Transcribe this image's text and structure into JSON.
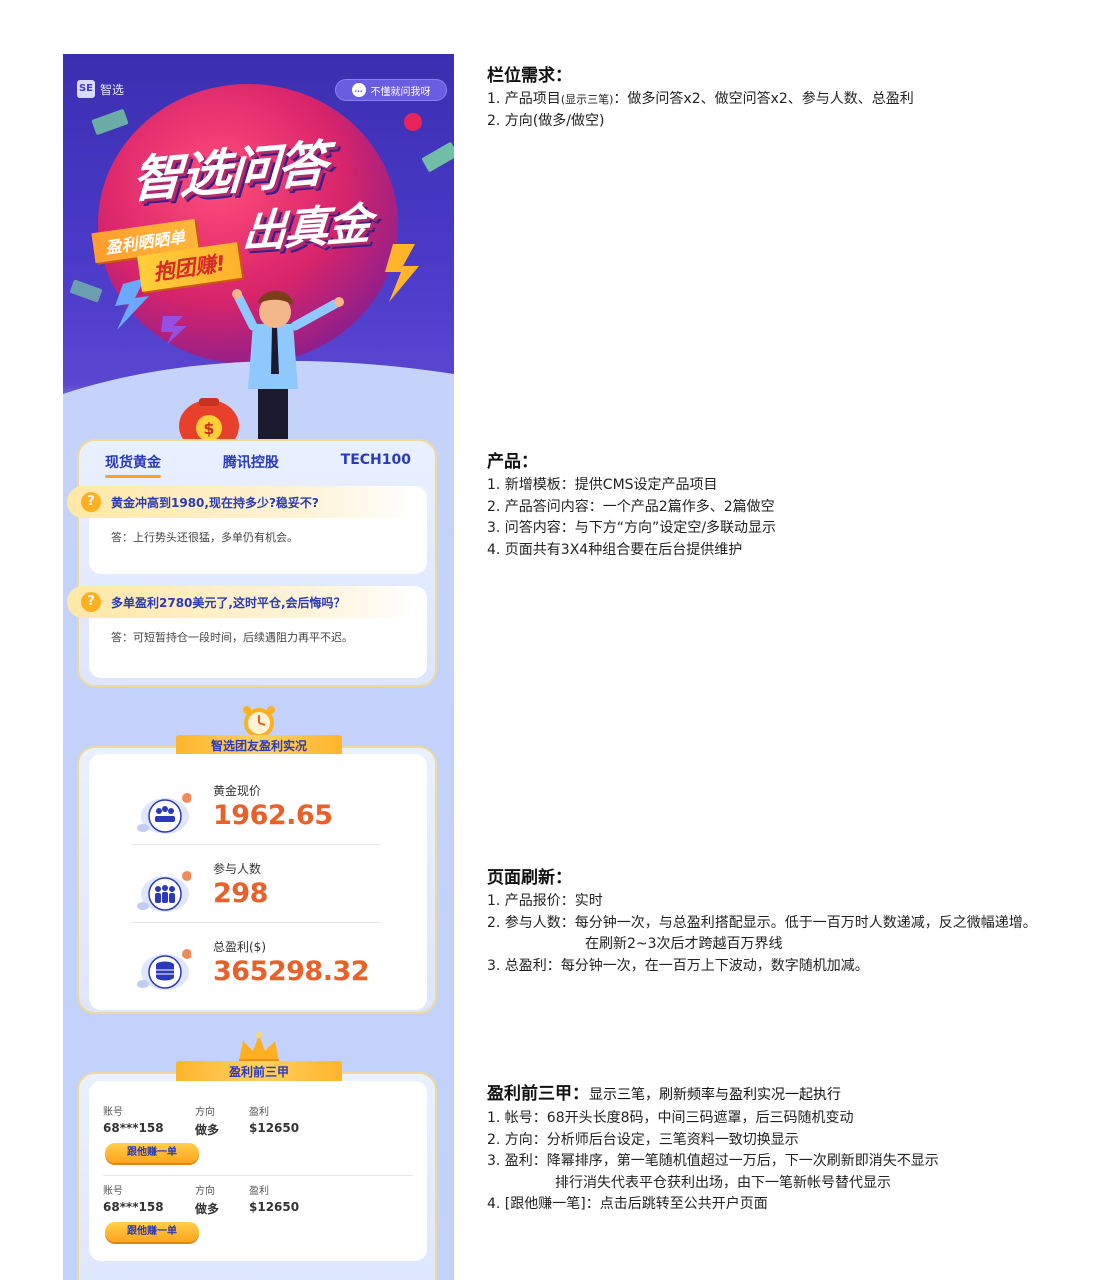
{
  "phone": {
    "logo": "智选",
    "help_button": "不懂就问我呀",
    "hero": {
      "title_line1": "智选问答",
      "title_line2": "出真金",
      "ribbon_small": "盈利晒晒单",
      "ribbon_big": "抱团赚!"
    },
    "tabs": [
      "现货黄金",
      "腾讯控股",
      "TECH100"
    ],
    "active_tab": 0,
    "qa": [
      {
        "q": "黄金冲高到1980,现在持多少?稳妥不?",
        "a": "答：上行势头还很猛，多单仍有机会。"
      },
      {
        "q": "多单盈利2780美元了,这时平仓,会后悔吗？",
        "a": "答：可短暂持仓一段时间，后续遇阻力再平不迟。"
      }
    ],
    "stats": {
      "title": "智选团友盈利实况",
      "items": [
        {
          "label": "黄金现价",
          "value": "1962.65",
          "icon": "group-meeting-icon"
        },
        {
          "label": "参与人数",
          "value": "298",
          "icon": "people-icon"
        },
        {
          "label": "总盈利($)",
          "value": "365298.32",
          "icon": "coins-icon"
        }
      ]
    },
    "top3": {
      "title": "盈利前三甲",
      "col_account": "账号",
      "col_direction": "方向",
      "col_profit": "盈利",
      "follow_label": "跟他赚一单",
      "rows": [
        {
          "account": "68***158",
          "direction": "做多",
          "profit": "$12650"
        },
        {
          "account": "68***158",
          "direction": "做多",
          "profit": "$12650"
        }
      ]
    },
    "colors": {
      "brand_blue": "#2a3ab8",
      "accent_orange": "#e8602a",
      "gold": "#ffb021"
    }
  },
  "notes": {
    "columns": {
      "heading": "栏位需求：",
      "line1_prefix": "1. 产品项目",
      "line1_small": "(显示三笔)",
      "line1_suffix": "：做多问答x2、做空问答x2、参与人数、总盈利",
      "line2": "2. 方向(做多/做空)"
    },
    "product": {
      "heading": "产品：",
      "lines": [
        "1. 新增模板：提供CMS设定产品项目",
        "2. 产品答问内容：一个产品2篇作多、2篇做空",
        "3. 问答内容：与下方“方向”设定空/多联动显示",
        "4. 页面共有3X4种组合要在后台提供维护"
      ]
    },
    "refresh": {
      "heading": "页面刷新：",
      "line1": "1. 产品报价：实时",
      "line2": "2. 参与人数：每分钟一次，与总盈利搭配显示。低于一百万时人数递减，反之微幅递增。",
      "line2_cont": "在刷新2~3次后才跨越百万界线",
      "line3": "3. 总盈利：每分钟一次，在一百万上下波动，数字随机加减。"
    },
    "top3": {
      "heading": "盈利前三甲：",
      "heading_sub": "显示三笔，刷新频率与盈利实况一起执行",
      "line1": "1. 帐号：68开头长度8码，中间三码遮罩，后三码随机变动",
      "line2": "2. 方向：分析师后台设定，三笔资料一致切换显示",
      "line3": "3. 盈利：降幂排序，第一笔随机值超过一万后，下一次刷新即消失不显示",
      "line3_cont": "排行消失代表平仓获利出场，由下一笔新帐号替代显示",
      "line4": "4. [跟他赚一笔]：点击后跳转至公共开户页面"
    }
  }
}
